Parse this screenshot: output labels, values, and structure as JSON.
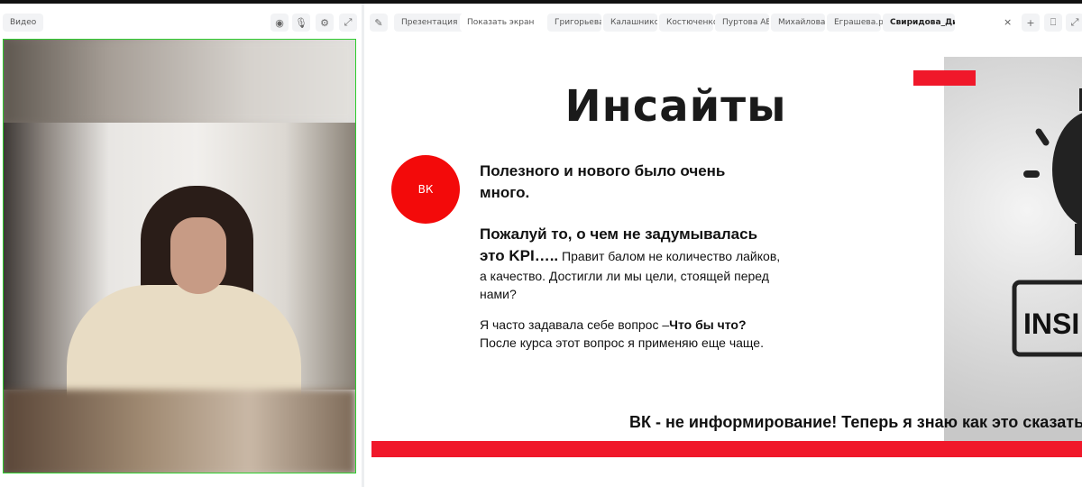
{
  "left_panel": {
    "title": "Видео",
    "icons": [
      "webcam-icon",
      "microphone-icon",
      "gear-icon",
      "expand-icon"
    ]
  },
  "toolbar": {
    "presentation": "Презентация",
    "show_screen": "Показать экран",
    "tabs": [
      "Григорьева К...",
      "Калашникова_",
      "Костюченко В",
      "Пуртова АЕ Ди",
      "Михайлова_ку",
      "Еграшева.pptx",
      "Свиридова_Дипл"
    ],
    "close": "×",
    "add": "+"
  },
  "slide": {
    "title": "Инсайты",
    "badge": "ВК",
    "p1": "Полезного и нового было очень много.",
    "p2_bold": "Пожалуй то, о чем не задумывалась это KPI…..",
    "p2_normal": " Правит балом не количество лайков, а качество. Достигли ли мы цели, стоящей перед нами?",
    "p3_a": "Я часто задавала себе вопрос –",
    "p3_bold": "Что бы что?",
    "p3_b": " После курса этот вопрос я применяю еще чаще.",
    "image_text": "INSI",
    "caption": "ВК - не информирование! Теперь я знаю как это сказать русским",
    "accent": "#f0182a"
  }
}
